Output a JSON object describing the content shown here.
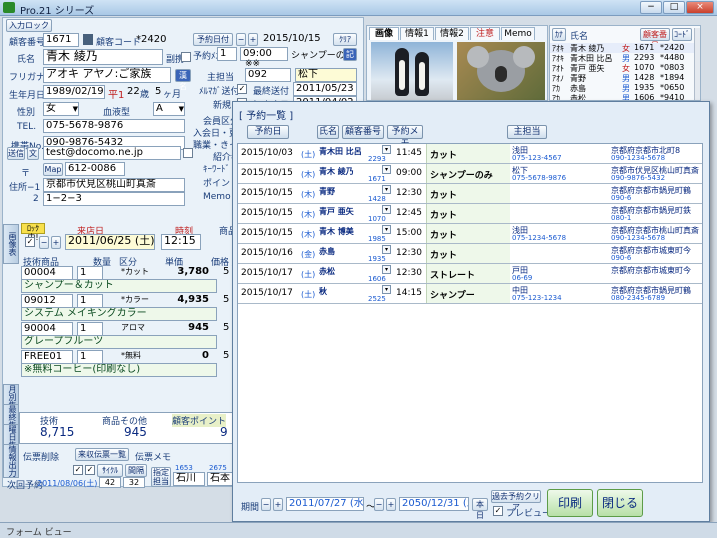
{
  "window": {
    "title": "Pro.21 シリーズ",
    "min": "−",
    "max": "□",
    "close": "×"
  },
  "taskbar": {
    "label": "フォーム ビュー"
  },
  "customer": {
    "login_label": "入力ロック",
    "number_label": "顧客番号",
    "number": "1671",
    "code_label": "顧客コード",
    "code": "*2420",
    "name_label": "氏名",
    "name": "青木 綾乃",
    "kana_label": "フリガナ",
    "kana": "アオキ アヤノ:ご家族",
    "birth_label": "生年月日",
    "birth": "1989/02/19",
    "era": "平1",
    "age": "22",
    "age_unit": "歳",
    "months": "5",
    "months_unit": "ヶ月",
    "gender_label": "性別",
    "gender": "女",
    "blood_label": "血液型",
    "blood": "A",
    "tel_label": "TEL.",
    "tel": "075-5678-9876",
    "mobile_label": "携帯No.",
    "mobile": "090-9876-5432",
    "mail_btn": "送信",
    "mail_btn2": "文",
    "email": "test@docomo.ne.jp",
    "zip_label": "〒",
    "map_btn": "Map",
    "zip": "612-0086",
    "addr1_label": "住所−1",
    "addr1": "京都市伏見区桃山町真斎",
    "addr2_label": "2",
    "addr2": "1−2−3",
    "reserve_date_btn": "予約日付",
    "reserve_date": "2015/10/15",
    "clear_btn": "ｸﾘｱ",
    "reserve_menu_label": "予約ﾒﾆｭｰ",
    "reserve_time": "09:00",
    "reserve_menu": "シャンプーのみ",
    "reserve_sub": "※※",
    "staff_label": "主担当",
    "staff_code": "092",
    "staff": "松下",
    "mail_send_label": "ﾒﾙﾏｶﾞ送付",
    "last_send_label": "最終送付",
    "last_send": "2011/05/23",
    "new_label": "新規",
    "first_visit_label": "初来店日",
    "first_visit": "2011/04/02",
    "member_label": "会員区分",
    "visit_label": "入会日・更新",
    "job_label": "職業・きっかけ",
    "intro_label": "紹介者",
    "keyword_label": "ｷｰﾜｰﾄﾞ",
    "point_label": "ポイント",
    "memo_label": "Memo",
    "fax_label": "副携",
    "kana_btn": "漢名"
  },
  "visit": {
    "lock_label": "ﾛｯｸ中!",
    "visit_label": "来店日",
    "visit_date": "2011/06/25",
    "visit_dow": "(土)",
    "time_label": "時刻",
    "time": "12:15",
    "prod_label": "商品",
    "col_item": "技術商品",
    "col_qty": "数量",
    "col_cat": "区分",
    "col_price": "単価",
    "col_note": "価格 / 税",
    "lines": [
      {
        "code": "00004",
        "qty": "1",
        "cat": "*カット",
        "price": "3,780",
        "name": "シャンプー＆カット",
        "tail": "5"
      },
      {
        "code": "09012",
        "qty": "1",
        "cat": "*カラー",
        "price": "4,935",
        "name": "システム メイキングカラー",
        "tail": "5"
      },
      {
        "code": "90004",
        "qty": "1",
        "cat": "アロマ",
        "price": "945",
        "name": "グレープフルーツ",
        "tail": "5"
      },
      {
        "code": "FREE01",
        "qty": "1",
        "cat": "*無料",
        "price": "0",
        "name": "※無料コーヒー(印刷なし)",
        "tail": "5"
      }
    ],
    "total_tech_label": "技術",
    "total_prod_label": "商品その他",
    "total_point_label": "顧客ポイント",
    "total_tech": "8,715",
    "total_prod": "945",
    "total_point": "9",
    "slip_delete": "伝票削除",
    "slip_list": "来収伝票一覧",
    "slip_memo": "伝票メモ",
    "next_label": "次回予約",
    "next_date": "2011/08/06(土)",
    "next_a": "42",
    "next_b": "32",
    "staff_code_a": "1653",
    "staff_code_b": "2675",
    "staff_a": "石川",
    "staff_b": "石本",
    "cycle_label": "ｻｲｸﾙ",
    "interval_label": "間隔",
    "pref_label": "指定",
    "interval2_label": "担当"
  },
  "side_tabs": [
    "画像表",
    "月別集計",
    "最終集計",
    "曜日集計",
    "情報出力"
  ],
  "photo_tabs": [
    "画像",
    "情報1",
    "情報2",
    "注意",
    "Memo"
  ],
  "right_list": {
    "col_kana": "ｶﾅ",
    "col_name": "氏名",
    "btn_num": "顧客番号",
    "btn_code": "ｺｰﾄﾞ",
    "rows": [
      {
        "kana": "ｱｵｷ",
        "name": "青木 綾乃",
        "sex": "女",
        "num": "1671",
        "code": "*2420"
      },
      {
        "kana": "ｱｵｷ",
        "name": "青木田 比呂",
        "sex": "男",
        "num": "2293",
        "code": "*4480"
      },
      {
        "kana": "ｱｵﾄ",
        "name": "青戸 亜矢",
        "sex": "女",
        "num": "1070",
        "code": "*0803"
      },
      {
        "kana": "ｱｵﾉ",
        "name": "青野",
        "sex": "男",
        "num": "1428",
        "code": "*1894"
      },
      {
        "kana": "ｱｶ",
        "name": "赤島",
        "sex": "男",
        "num": "1935",
        "code": "*0650"
      },
      {
        "kana": "ｱｶ",
        "name": "赤松",
        "sex": "男",
        "num": "1606",
        "code": "*9410"
      }
    ]
  },
  "dialog": {
    "title": "[ 予約一覧 ]",
    "btn_date": "予約日",
    "btn_name": "氏名",
    "btn_num": "顧客番号",
    "btn_memo": "予約メモ",
    "btn_staff": "主担当",
    "rows": [
      {
        "date": "2015/10/03",
        "dow": "(土)",
        "name": "青木田 比呂",
        "num": "2293",
        "time": "11:45",
        "menu": "カット",
        "staff": "浅田",
        "tel1": "075-123-4567",
        "addr": "京都府京都市北町8",
        "tel2": "090-1234-5678"
      },
      {
        "date": "2015/10/15",
        "dow": "(木)",
        "name": "青木 綾乃",
        "num": "1671",
        "time": "09:00",
        "menu": "シャンプーのみ",
        "staff": "松下",
        "tel1": "075-5678-9876",
        "addr": "京都市伏見区桃山町真斎",
        "tel2": "090-9876-5432"
      },
      {
        "date": "2015/10/15",
        "dow": "(木)",
        "name": "青野",
        "num": "1428",
        "time": "12:30",
        "menu": "カット",
        "staff": "",
        "tel1": "",
        "addr": "京都府京都市鍋見町鶴",
        "tel2": "090-6"
      },
      {
        "date": "2015/10/15",
        "dow": "(木)",
        "name": "青戸 亜矢",
        "num": "1070",
        "time": "12:45",
        "menu": "カット",
        "staff": "",
        "tel1": "",
        "addr": "京都府京都市鍋見町鉄",
        "tel2": "080-1"
      },
      {
        "date": "2015/10/15",
        "dow": "(木)",
        "name": "青木 博美",
        "num": "1985",
        "time": "15:00",
        "menu": "カット",
        "staff": "浅田",
        "tel1": "075-1234-5678",
        "addr": "京都府京都市桃山町真斎",
        "tel2": "090-1234-5678"
      },
      {
        "date": "2015/10/16",
        "dow": "(金)",
        "name": "赤島",
        "num": "1935",
        "time": "12:30",
        "menu": "カット",
        "staff": "",
        "tel1": "",
        "addr": "京都府京都市城東町今",
        "tel2": "090-6"
      },
      {
        "date": "2015/10/17",
        "dow": "(土)",
        "name": "赤松",
        "num": "1606",
        "time": "12:30",
        "menu": "ストレート",
        "staff": "戸田",
        "tel1": "06-69",
        "addr": "京都府京都市城東町今",
        "tel2": ""
      },
      {
        "date": "2015/10/17",
        "dow": "(土)",
        "name": "秋",
        "num": "2525",
        "time": "14:15",
        "menu": "シャンプー",
        "staff": "中田",
        "tel1": "075-123-1234",
        "addr": "京都府京都市鍋見町鶴",
        "tel2": "080-2345-6789"
      }
    ],
    "period_label": "期間",
    "period_from": "2011/07/27 (水)",
    "period_sep": "〜",
    "period_to": "2050/12/31 (土)",
    "today_btn": "本日",
    "clear_btn": "過去予約クリア",
    "preview_label": "プレビュー",
    "print_btn": "印刷",
    "close_btn": "閉じる"
  }
}
